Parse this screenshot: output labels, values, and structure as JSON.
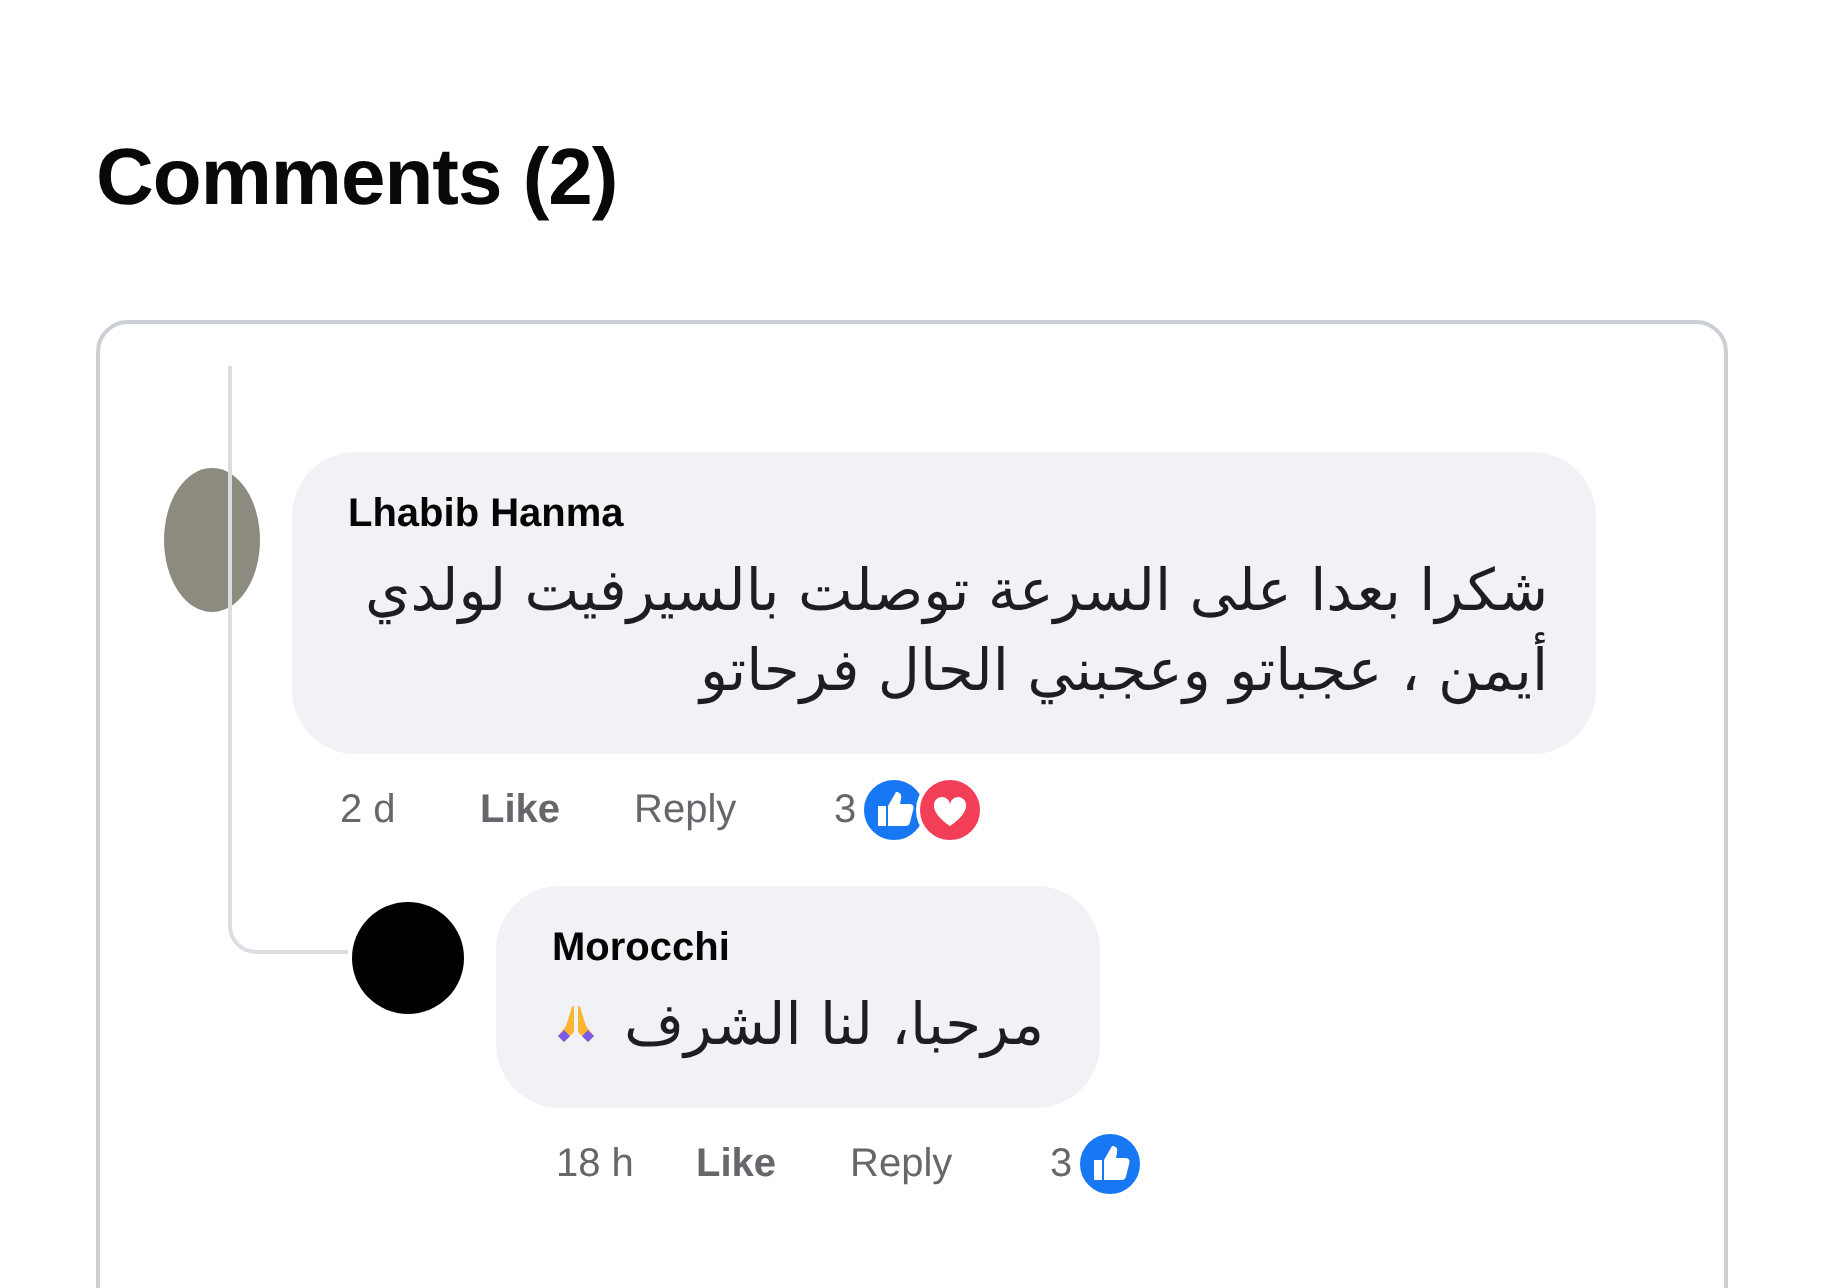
{
  "heading": "Comments (2)",
  "comments": [
    {
      "kind": "top",
      "avatar": {
        "kind": "photo"
      },
      "author": "Lhabib Hanma",
      "text": "شكرا بعدا على السرعة توصلت بالسيرفيت لولدي أيمن ، عجباتو وعجبني الحال فرحاتو",
      "emoji": false,
      "time": "2 d",
      "like": "Like",
      "reply": "Reply",
      "reaction_count": "3",
      "reactions": [
        {
          "kind": "like"
        },
        {
          "kind": "love"
        }
      ]
    },
    {
      "kind": "reply",
      "avatar": {
        "kind": "logo"
      },
      "author": "Morocchi",
      "text": "مرحبا، لنا الشرف",
      "emoji": true,
      "time": "18 h",
      "like": "Like",
      "reply": "Reply",
      "reaction_count": "3",
      "reactions": [
        {
          "kind": "like"
        }
      ]
    }
  ]
}
